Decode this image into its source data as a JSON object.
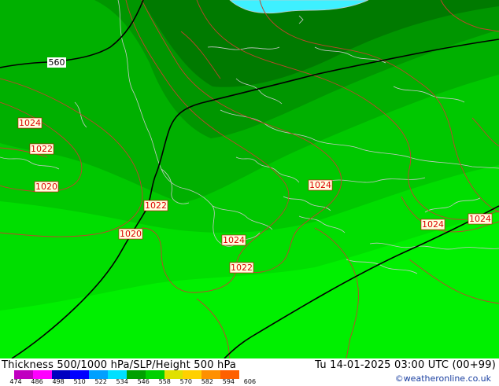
{
  "map": {
    "isoline_labels": {
      "thickness": [
        "560"
      ],
      "pressure": [
        "1024",
        "1022",
        "1020",
        "1022",
        "1020",
        "1024",
        "1022",
        "1024",
        "1024",
        "1024"
      ]
    },
    "colors": {
      "sea": "#3ef0ff",
      "thickness_line": "#000000",
      "isobar": "#c0442c",
      "coast": "#c8c8c8",
      "label_text": "#dd0000"
    }
  },
  "footer": {
    "title": "Thickness 500/1000 hPa/SLP/Height 500 hPa",
    "datetime": "Tu 14-01-2025 03:00 UTC (00+99)",
    "credit": "©weatheronline.co.uk",
    "scale": {
      "ticks": [
        "474",
        "486",
        "498",
        "510",
        "522",
        "534",
        "546",
        "558",
        "570",
        "582",
        "594",
        "606"
      ],
      "colors": [
        "#c000c0",
        "#ff00ff",
        "#0000c0",
        "#0000ff",
        "#00a0ff",
        "#00e0ff",
        "#00a000",
        "#00d000",
        "#e0e000",
        "#ffd000",
        "#ff9000",
        "#ff6000"
      ]
    }
  }
}
